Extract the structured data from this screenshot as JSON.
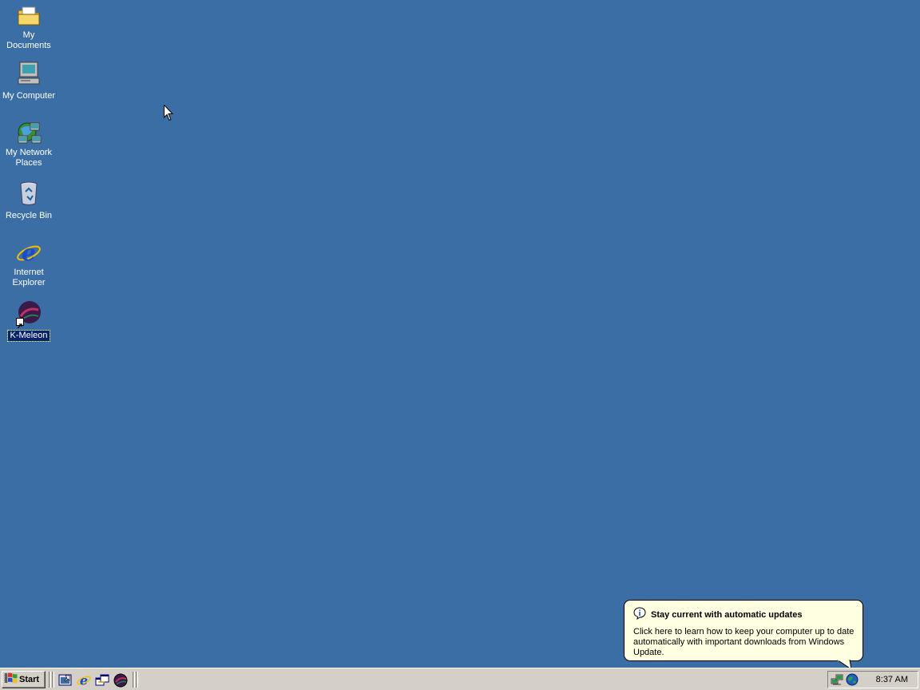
{
  "desktop": {
    "icons": [
      {
        "label": "My Documents"
      },
      {
        "label": "My Computer"
      },
      {
        "label": "My Network Places"
      },
      {
        "label": "Recycle Bin"
      },
      {
        "label": "Internet Explorer"
      },
      {
        "label": "K-Meleon"
      }
    ]
  },
  "balloon": {
    "title": "Stay current with automatic updates",
    "body": "Click here to learn how to keep your computer up to date automatically with important downloads from Windows Update."
  },
  "taskbar": {
    "start_label": "Start",
    "quick_launch": [
      "show-desktop-icon",
      "internet-explorer-icon",
      "switch-windows-icon",
      "k-meleon-icon"
    ],
    "tray_icons": [
      "network-icon",
      "windows-update-icon"
    ],
    "clock": "8:37 AM"
  },
  "colors": {
    "desktop_background": "#3a6ea5",
    "taskbar": "#d4d0c8",
    "balloon_background": "#ffffe1",
    "selection": "#0a246a"
  }
}
